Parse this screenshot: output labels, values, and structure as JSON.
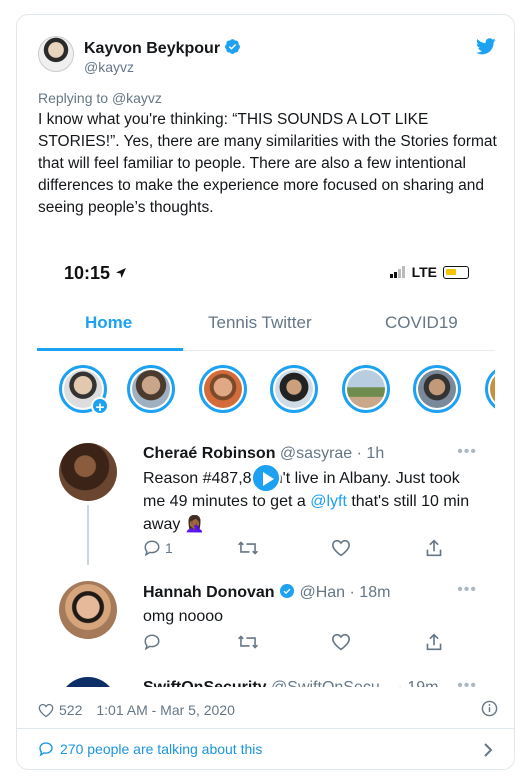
{
  "tweet": {
    "author_name": "Kayvon Beykpour",
    "author_handle": "@kayvz",
    "replying_to_prefix": "Replying to",
    "replying_to_handle": "@kayvz",
    "text": "I know what you're thinking: “THIS SOUNDS A LOT LIKE STORIES!”. Yes, there are many similarities with the Stories format that will feel familiar to people. There are also a few intentional differences to make the experience more focused on sharing and seeing people’s thoughts.",
    "likes": "522",
    "timestamp": "1:01 AM - Mar 5, 2020",
    "conversation": "270 people are talking about this"
  },
  "phone": {
    "time": "10:15",
    "network": "LTE",
    "tabs": [
      "Home",
      "Tennis Twitter",
      "COVID19"
    ],
    "active_tab": 0,
    "tweets": [
      {
        "name": "Cheraé Robinson",
        "handle": "@sasyrae",
        "age": "· 1h",
        "text_before": "Reason #487,89",
        "text_middle": " an't live in Albany. Just took me 49 minutes to get a ",
        "link": "@lyft",
        "text_after": " that's still 10 min away 🤦🏾‍♀️",
        "replies": "1"
      },
      {
        "name": "Hannah Donovan",
        "handle": "@Han",
        "age": "· 18m",
        "text": "omg noooo"
      },
      {
        "name": "SwiftOnSecurity",
        "handle": "@SwiftOnSecu...",
        "age": "· 19m"
      }
    ]
  },
  "colors": {
    "accent": "#1da1f2",
    "muted": "#657786",
    "text": "#14171a"
  }
}
